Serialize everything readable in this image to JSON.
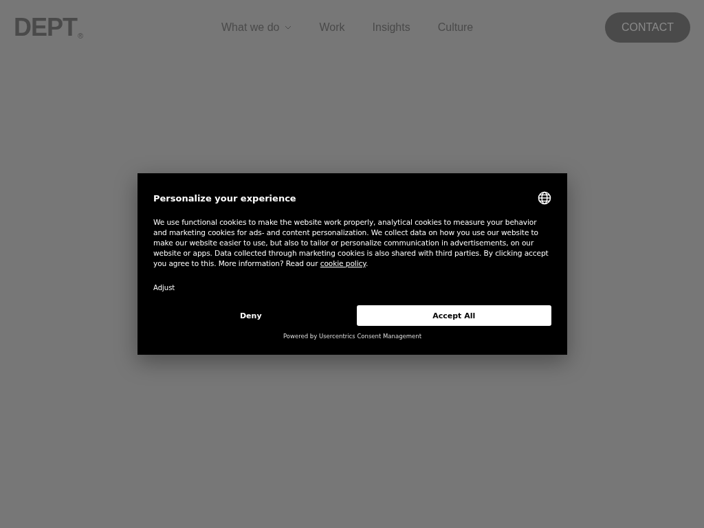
{
  "header": {
    "logo": "DEPT",
    "logo_mark": "®",
    "nav": [
      {
        "label": "What we do",
        "dropdown": true
      },
      {
        "label": "Work",
        "dropdown": false
      },
      {
        "label": "Insights",
        "dropdown": false
      },
      {
        "label": "Culture",
        "dropdown": false
      }
    ],
    "contact_button": "CONTACT"
  },
  "consent_dialog": {
    "title": "Personalize your experience",
    "body": "We use functional cookies to make the website work properly, analytical cookies to measure your behavior and marketing cookies for ads- and content personalization. We collect data on how you use our website to make our website easier to use, but also to tailor or personalize communication in advertisements, on our website or apps. Data collected through marketing cookies is also shared with third parties. By clicking accept you agree to this. More information? Read our",
    "link": "cookie policy",
    "body_end": ".",
    "adjust": "Adjust",
    "deny": "Deny",
    "accept": "Accept All",
    "footer": "Powered by Usercentrics Consent Management"
  }
}
